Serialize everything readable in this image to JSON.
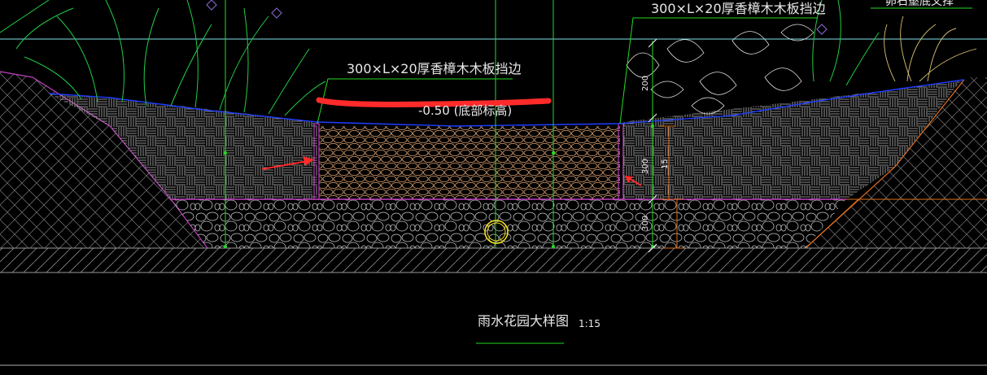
{
  "drawing": {
    "label_center": "300×L×20厚香樟木木板挡边",
    "label_right": "300×L×20厚香樟木木板挡边",
    "label_top_right_partial": "卵石壑底文择",
    "elevation_label": "-0.50 (底部标高)",
    "title": "雨水花园大样图",
    "scale": "1:15",
    "dim_200": "200",
    "dim_300_upper": "300",
    "dim_15": "15",
    "dim_300_lower": "300"
  },
  "colors": {
    "background": "#000000",
    "green": "#22dd22",
    "cyan": "#7fe0e8",
    "blue": "#1f3dff",
    "magenta": "#c040c0",
    "orange": "#e07020",
    "pebble": "#d9a070",
    "red_mark": "#ff2a2a",
    "yellow": "#f0e020",
    "grey": "#b0b0b0",
    "hatch": "#9a9a9a"
  }
}
